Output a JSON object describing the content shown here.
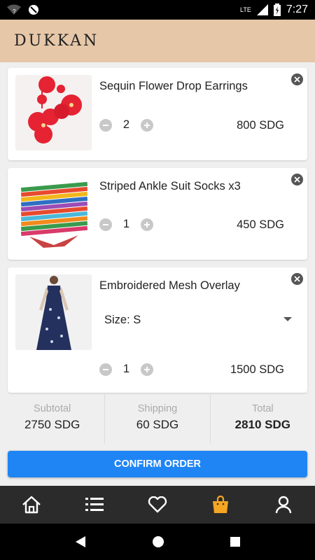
{
  "status_bar": {
    "time": "7:27",
    "network": "LTE"
  },
  "header": {
    "brand": "DUKKAN"
  },
  "cart": {
    "items": [
      {
        "name": "Sequin Flower Drop Earrings",
        "quantity": "2",
        "price": "800 SDG"
      },
      {
        "name": "Striped Ankle Suit Socks x3",
        "quantity": "1",
        "price": "450 SDG"
      },
      {
        "name": "Embroidered Mesh Overlay",
        "size_label": "Size: S",
        "quantity": "1",
        "price": "1500 SDG"
      }
    ]
  },
  "totals": {
    "subtotal_label": "Subtotal",
    "subtotal_value": "2750 SDG",
    "shipping_label": "Shipping",
    "shipping_value": "60 SDG",
    "total_label": "Total",
    "total_value": "2810 SDG"
  },
  "actions": {
    "confirm_label": "CONFIRM ORDER"
  },
  "bottom_nav": {
    "items": [
      "home-icon",
      "list-icon",
      "heart-icon",
      "shopping-bag-icon",
      "user-icon"
    ],
    "active": "shopping-bag-icon",
    "active_color": "#f5a623"
  },
  "colors": {
    "header_bg": "#e6c7a8",
    "accent": "#1f85f5",
    "nav_bg": "#2b2b2b"
  }
}
